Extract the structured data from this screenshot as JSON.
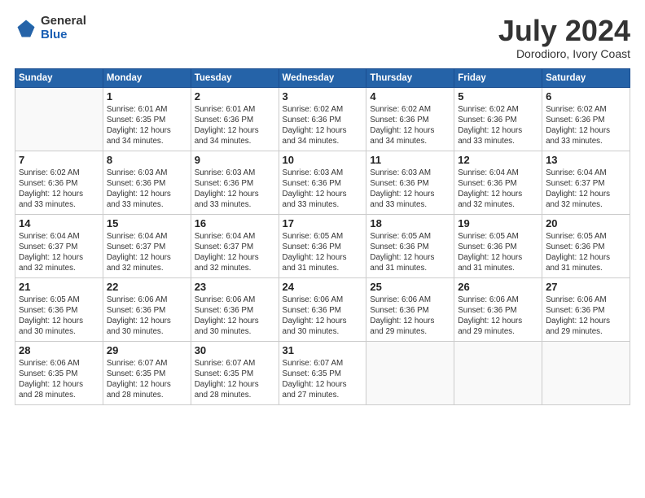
{
  "logo": {
    "general": "General",
    "blue": "Blue"
  },
  "header": {
    "month": "July 2024",
    "location": "Dorodioro, Ivory Coast"
  },
  "weekdays": [
    "Sunday",
    "Monday",
    "Tuesday",
    "Wednesday",
    "Thursday",
    "Friday",
    "Saturday"
  ],
  "weeks": [
    [
      {
        "day": "",
        "info": ""
      },
      {
        "day": "1",
        "info": "Sunrise: 6:01 AM\nSunset: 6:35 PM\nDaylight: 12 hours\nand 34 minutes."
      },
      {
        "day": "2",
        "info": "Sunrise: 6:01 AM\nSunset: 6:36 PM\nDaylight: 12 hours\nand 34 minutes."
      },
      {
        "day": "3",
        "info": "Sunrise: 6:02 AM\nSunset: 6:36 PM\nDaylight: 12 hours\nand 34 minutes."
      },
      {
        "day": "4",
        "info": "Sunrise: 6:02 AM\nSunset: 6:36 PM\nDaylight: 12 hours\nand 34 minutes."
      },
      {
        "day": "5",
        "info": "Sunrise: 6:02 AM\nSunset: 6:36 PM\nDaylight: 12 hours\nand 33 minutes."
      },
      {
        "day": "6",
        "info": "Sunrise: 6:02 AM\nSunset: 6:36 PM\nDaylight: 12 hours\nand 33 minutes."
      }
    ],
    [
      {
        "day": "7",
        "info": "Sunrise: 6:02 AM\nSunset: 6:36 PM\nDaylight: 12 hours\nand 33 minutes."
      },
      {
        "day": "8",
        "info": "Sunrise: 6:03 AM\nSunset: 6:36 PM\nDaylight: 12 hours\nand 33 minutes."
      },
      {
        "day": "9",
        "info": "Sunrise: 6:03 AM\nSunset: 6:36 PM\nDaylight: 12 hours\nand 33 minutes."
      },
      {
        "day": "10",
        "info": "Sunrise: 6:03 AM\nSunset: 6:36 PM\nDaylight: 12 hours\nand 33 minutes."
      },
      {
        "day": "11",
        "info": "Sunrise: 6:03 AM\nSunset: 6:36 PM\nDaylight: 12 hours\nand 33 minutes."
      },
      {
        "day": "12",
        "info": "Sunrise: 6:04 AM\nSunset: 6:36 PM\nDaylight: 12 hours\nand 32 minutes."
      },
      {
        "day": "13",
        "info": "Sunrise: 6:04 AM\nSunset: 6:37 PM\nDaylight: 12 hours\nand 32 minutes."
      }
    ],
    [
      {
        "day": "14",
        "info": "Sunrise: 6:04 AM\nSunset: 6:37 PM\nDaylight: 12 hours\nand 32 minutes."
      },
      {
        "day": "15",
        "info": "Sunrise: 6:04 AM\nSunset: 6:37 PM\nDaylight: 12 hours\nand 32 minutes."
      },
      {
        "day": "16",
        "info": "Sunrise: 6:04 AM\nSunset: 6:37 PM\nDaylight: 12 hours\nand 32 minutes."
      },
      {
        "day": "17",
        "info": "Sunrise: 6:05 AM\nSunset: 6:36 PM\nDaylight: 12 hours\nand 31 minutes."
      },
      {
        "day": "18",
        "info": "Sunrise: 6:05 AM\nSunset: 6:36 PM\nDaylight: 12 hours\nand 31 minutes."
      },
      {
        "day": "19",
        "info": "Sunrise: 6:05 AM\nSunset: 6:36 PM\nDaylight: 12 hours\nand 31 minutes."
      },
      {
        "day": "20",
        "info": "Sunrise: 6:05 AM\nSunset: 6:36 PM\nDaylight: 12 hours\nand 31 minutes."
      }
    ],
    [
      {
        "day": "21",
        "info": "Sunrise: 6:05 AM\nSunset: 6:36 PM\nDaylight: 12 hours\nand 30 minutes."
      },
      {
        "day": "22",
        "info": "Sunrise: 6:06 AM\nSunset: 6:36 PM\nDaylight: 12 hours\nand 30 minutes."
      },
      {
        "day": "23",
        "info": "Sunrise: 6:06 AM\nSunset: 6:36 PM\nDaylight: 12 hours\nand 30 minutes."
      },
      {
        "day": "24",
        "info": "Sunrise: 6:06 AM\nSunset: 6:36 PM\nDaylight: 12 hours\nand 30 minutes."
      },
      {
        "day": "25",
        "info": "Sunrise: 6:06 AM\nSunset: 6:36 PM\nDaylight: 12 hours\nand 29 minutes."
      },
      {
        "day": "26",
        "info": "Sunrise: 6:06 AM\nSunset: 6:36 PM\nDaylight: 12 hours\nand 29 minutes."
      },
      {
        "day": "27",
        "info": "Sunrise: 6:06 AM\nSunset: 6:36 PM\nDaylight: 12 hours\nand 29 minutes."
      }
    ],
    [
      {
        "day": "28",
        "info": "Sunrise: 6:06 AM\nSunset: 6:35 PM\nDaylight: 12 hours\nand 28 minutes."
      },
      {
        "day": "29",
        "info": "Sunrise: 6:07 AM\nSunset: 6:35 PM\nDaylight: 12 hours\nand 28 minutes."
      },
      {
        "day": "30",
        "info": "Sunrise: 6:07 AM\nSunset: 6:35 PM\nDaylight: 12 hours\nand 28 minutes."
      },
      {
        "day": "31",
        "info": "Sunrise: 6:07 AM\nSunset: 6:35 PM\nDaylight: 12 hours\nand 27 minutes."
      },
      {
        "day": "",
        "info": ""
      },
      {
        "day": "",
        "info": ""
      },
      {
        "day": "",
        "info": ""
      }
    ]
  ]
}
